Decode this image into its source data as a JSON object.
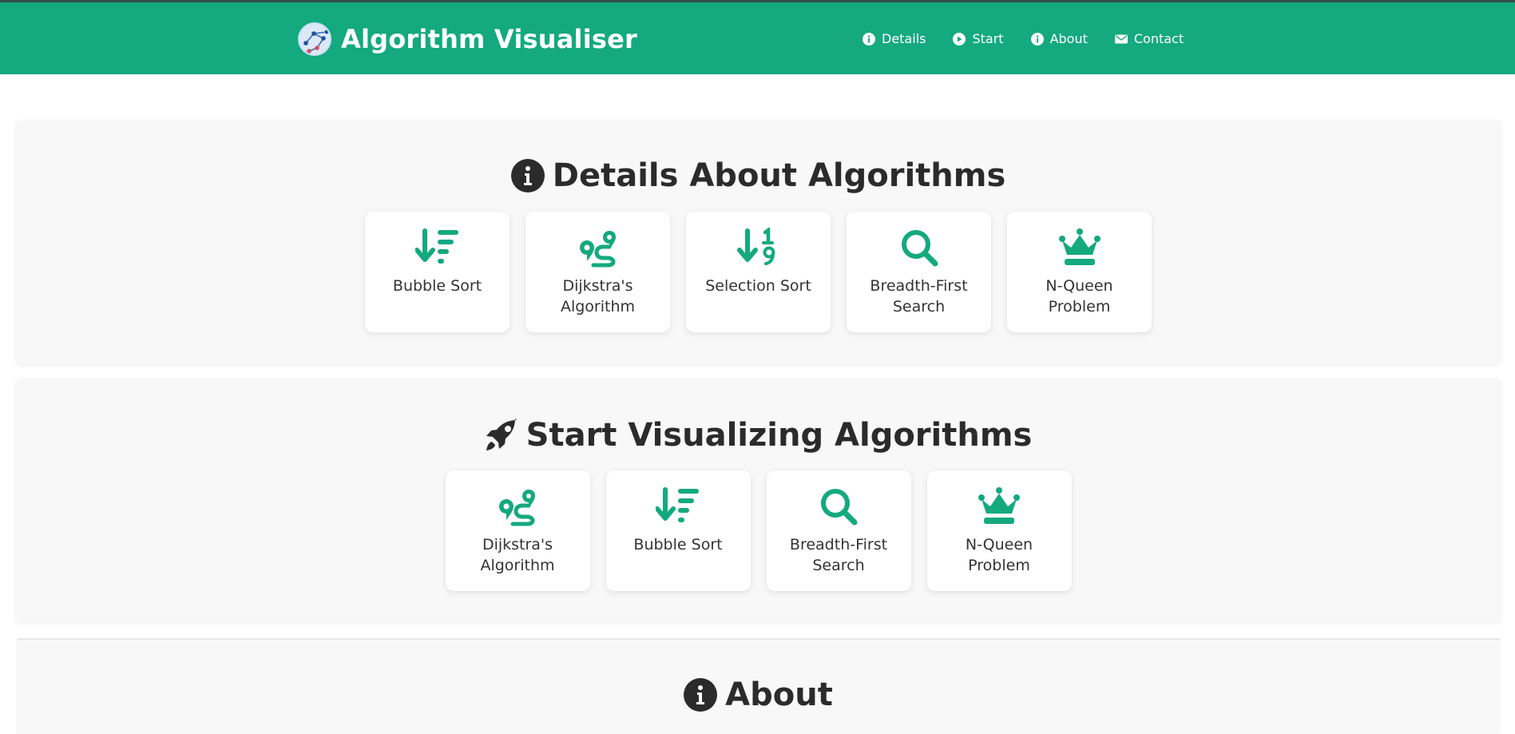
{
  "colors": {
    "brand": "#14a97f",
    "header_border": "#2f4f4a",
    "section_bg": "#f8f8f8",
    "text": "#2b2b2b"
  },
  "header": {
    "title": "Algorithm Visualiser",
    "logo_icon": "graph-logo-icon",
    "nav": [
      {
        "label": "Details",
        "icon": "info-circle-icon"
      },
      {
        "label": "Start",
        "icon": "play-circle-icon"
      },
      {
        "label": "About",
        "icon": "info-circle-icon"
      },
      {
        "label": "Contact",
        "icon": "envelope-icon"
      }
    ]
  },
  "details": {
    "title": "Details About Algorithms",
    "icon": "info-circle-icon",
    "cards": [
      {
        "label": "Bubble Sort",
        "icon": "sort-down-lines-icon"
      },
      {
        "label": "Dijkstra's Algorithm",
        "icon": "route-icon"
      },
      {
        "label": "Selection Sort",
        "icon": "sort-numeric-down-icon"
      },
      {
        "label": "Breadth-First Search",
        "icon": "magnifying-glass-icon"
      },
      {
        "label": "N-Queen Problem",
        "icon": "chess-queen-icon"
      }
    ]
  },
  "start": {
    "title": "Start Visualizing Algorithms",
    "icon": "rocket-icon",
    "cards": [
      {
        "label": "Dijkstra's Algorithm",
        "icon": "route-icon"
      },
      {
        "label": "Bubble Sort",
        "icon": "sort-down-lines-icon"
      },
      {
        "label": "Breadth-First Search",
        "icon": "magnifying-glass-icon"
      },
      {
        "label": "N-Queen Problem",
        "icon": "chess-queen-icon"
      }
    ]
  },
  "about": {
    "title": "About",
    "icon": "info-circle-icon"
  }
}
